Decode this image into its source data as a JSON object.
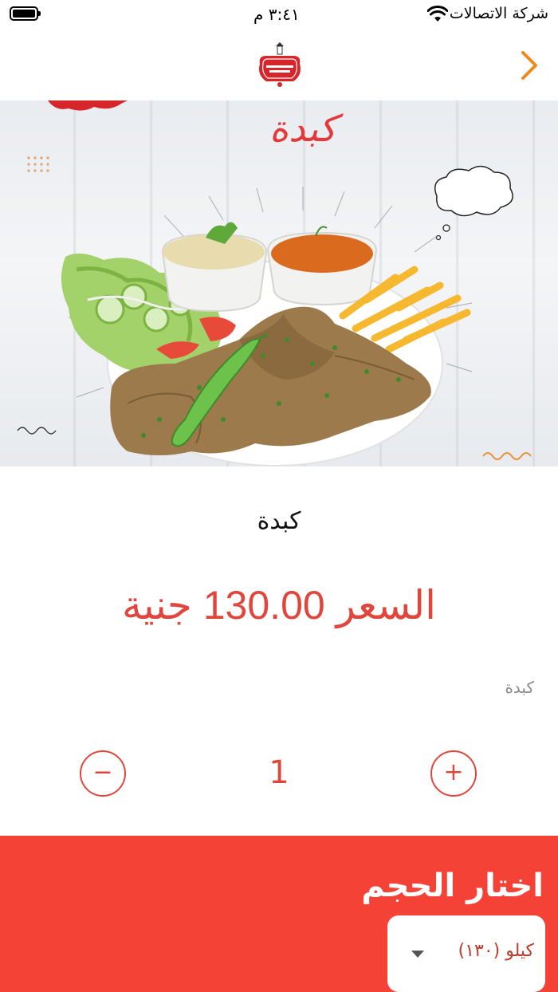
{
  "status_bar": {
    "carrier": "شركة الاتصالات",
    "time": "٣:٤١ م"
  },
  "nav": {
    "back_icon": "chevron-right-icon",
    "logo_icon": "restaurant-logo-icon"
  },
  "hero": {
    "caption": "كبدة",
    "image": "liver-meal-photo"
  },
  "product": {
    "name": "كبدة",
    "price": "السعر 130.00 جنية",
    "description": "كبدة"
  },
  "quantity": {
    "minus_label": "−",
    "value": "1",
    "plus_label": "+"
  },
  "size": {
    "title": "اختار الحجم",
    "selected": "كيلو    (١٣٠)",
    "arrow_icon": "dropdown-arrow-icon"
  },
  "colors": {
    "accent": "#e0463c",
    "size_bg": "#f44336"
  }
}
